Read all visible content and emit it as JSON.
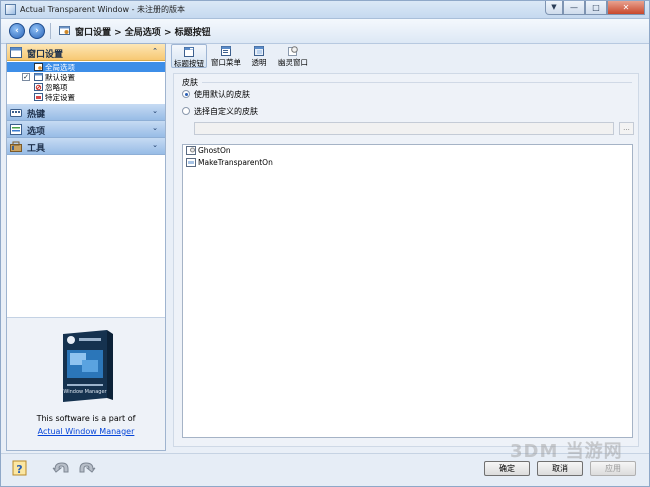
{
  "window": {
    "title": "Actual Transparent Window - 未注册的版本",
    "caption_buttons": {
      "extra": "▼",
      "minimize": "—",
      "maximize": "□",
      "close": "✕"
    }
  },
  "addressbar": {
    "back_icon": "back-arrow-icon",
    "forward_icon": "forward-arrow-icon",
    "breadcrumb": "窗口设置 > 全局选项 > 标题按钮"
  },
  "sidebar": {
    "sections": [
      {
        "label": "窗口设置",
        "icon": "window-settings-icon",
        "chevron": "⌃",
        "open": true,
        "items": [
          {
            "label": "全局选项",
            "icon": "global-options-icon",
            "selected": true,
            "checkbox": false
          },
          {
            "label": "默认设置",
            "icon": "default-settings-icon",
            "selected": false,
            "checkbox": true
          },
          {
            "label": "忽略项",
            "icon": "exclusions-icon",
            "selected": false,
            "checkbox": false
          },
          {
            "label": "特定设置",
            "icon": "specific-settings-icon",
            "selected": false,
            "checkbox": false
          }
        ]
      },
      {
        "label": "热键",
        "icon": "hotkeys-icon",
        "chevron": "⌄",
        "open": false
      },
      {
        "label": "选项",
        "icon": "options-icon",
        "chevron": "⌄",
        "open": false
      },
      {
        "label": "工具",
        "icon": "tools-icon",
        "chevron": "⌄",
        "open": false
      }
    ],
    "promo": {
      "text": "This software is a part of",
      "link": "Actual Window Manager",
      "box_label": "Window Manager"
    }
  },
  "tabs": [
    {
      "label": "标题按钮",
      "icon": "title-buttons-icon",
      "selected": true
    },
    {
      "label": "窗口菜单",
      "icon": "window-menu-icon",
      "selected": false
    },
    {
      "label": "透明",
      "icon": "transparency-icon",
      "selected": false
    },
    {
      "label": "幽灵窗口",
      "icon": "ghost-window-icon",
      "selected": false
    }
  ],
  "skin": {
    "group_label": "皮肤",
    "option_default": "使用默认的皮肤",
    "option_custom": "选择自定义的皮肤",
    "selected_option": "default",
    "path_value": "",
    "browse_label": "...",
    "items": [
      "GhostOn",
      "MakeTransparentOn"
    ]
  },
  "footer": {
    "ok_label": "确定",
    "cancel_label": "取消",
    "apply_label": "应用"
  },
  "watermark": "3DM 当游网",
  "colors": {
    "selection": "#3d8ee8",
    "section_open": "#f7c873",
    "section": "#98bce6",
    "link": "#0645d8"
  }
}
